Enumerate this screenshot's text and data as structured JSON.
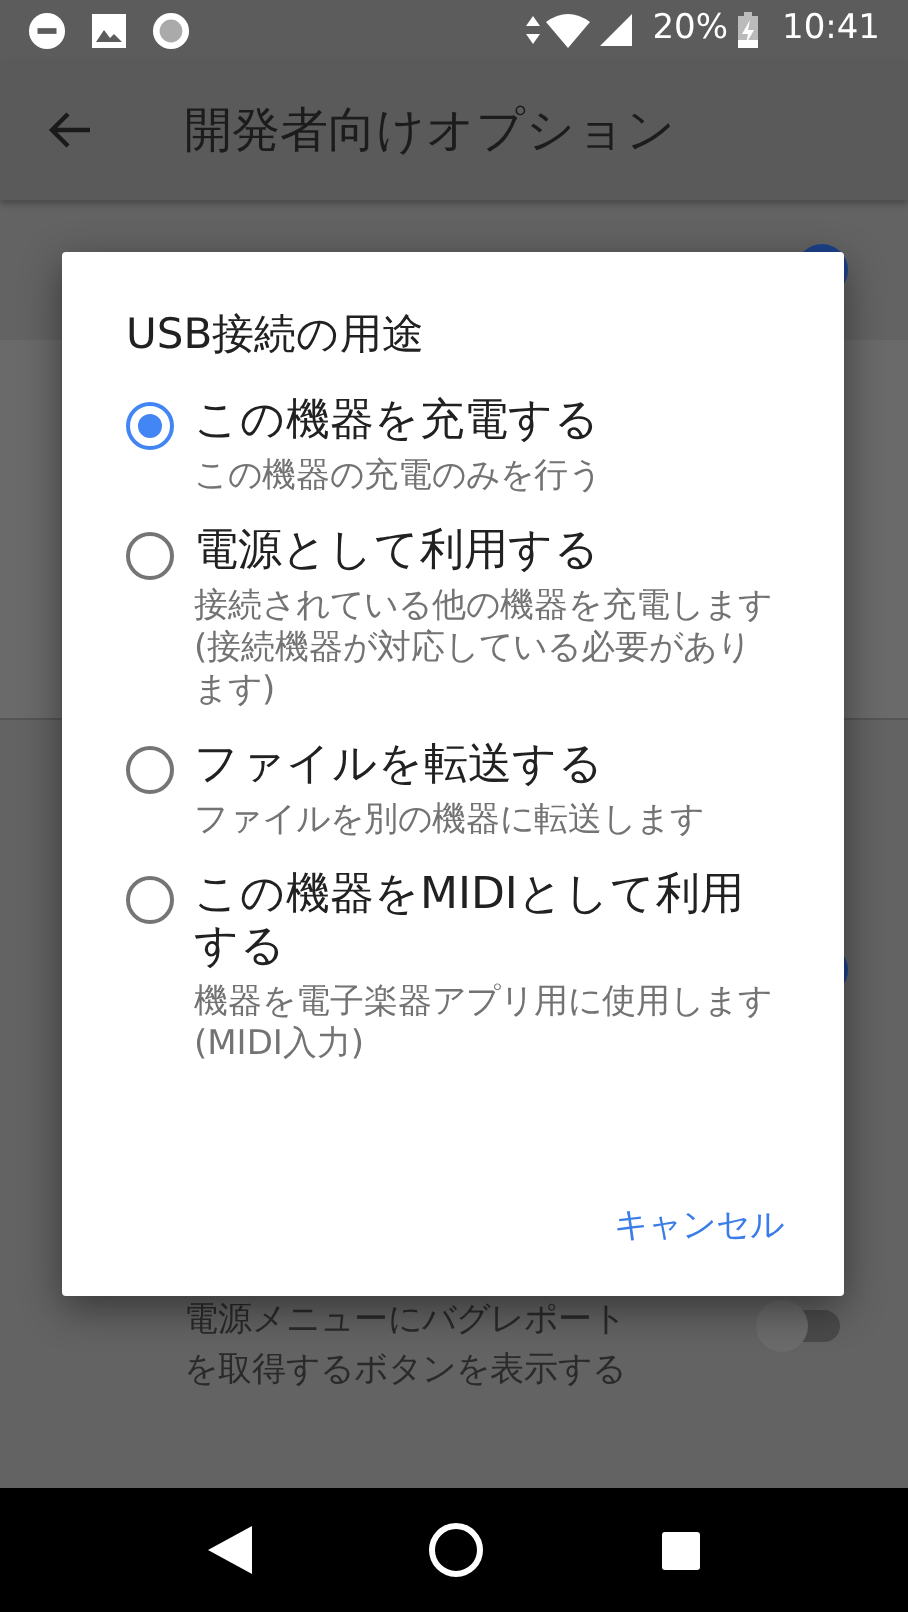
{
  "status_bar": {
    "battery": "20%",
    "time": "10:41"
  },
  "app_bar": {
    "title": "開発者向けオプション"
  },
  "settings_rows": [
    {
      "kind": "toggle",
      "on": true
    },
    {
      "kind": "panel"
    },
    {
      "kind": "spacer"
    },
    {
      "kind": "toggle",
      "on": true
    },
    {
      "kind": "toggle",
      "on": false,
      "summary": "電源メニューにバグレポートを取得するボタンを表示する"
    }
  ],
  "dialog": {
    "title": "USB接続の用途",
    "options": [
      {
        "label": "この機器を充電する",
        "summary": "この機器の充電のみを行う",
        "selected": true
      },
      {
        "label": "電源として利用する",
        "summary": "接続されている他の機器を充電します(接続機器が対応している必要があります)",
        "selected": false
      },
      {
        "label": "ファイルを転送する",
        "summary": "ファイルを別の機器に転送します",
        "selected": false
      },
      {
        "label": "この機器をMIDIとして利用する",
        "summary": "機器を電子楽器アプリ用に使用します(MIDI入力)",
        "selected": false
      }
    ],
    "buttons": [
      "キャンセル"
    ]
  }
}
